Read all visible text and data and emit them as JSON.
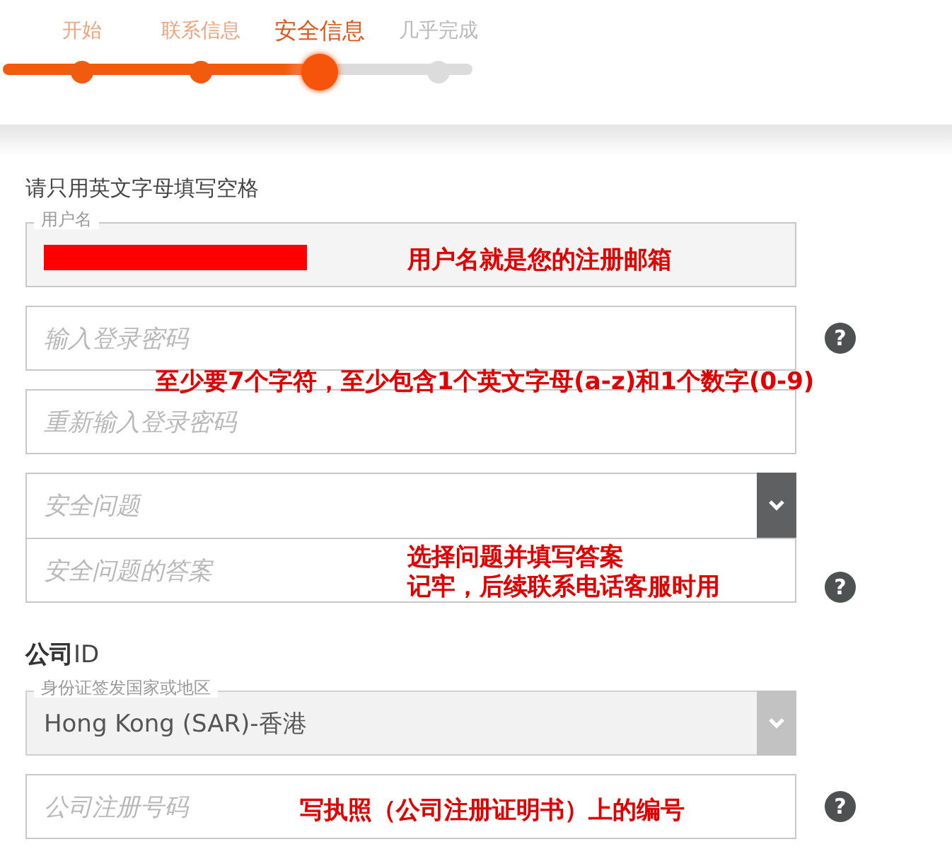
{
  "steps": [
    {
      "label": "开始",
      "kind": "done"
    },
    {
      "label": "联系信息",
      "kind": "done"
    },
    {
      "label": "安全信息",
      "kind": "current"
    },
    {
      "label": "几乎完成",
      "kind": "todo"
    }
  ],
  "form": {
    "instruction": "请只用英文字母填写空格",
    "fields": [
      {
        "kind": "text",
        "label": "用户名",
        "redacted": true,
        "disabled": false
      },
      {
        "kind": "text",
        "placeholder": "输入登录密码",
        "help": "?",
        "disabled": false
      },
      {
        "kind": "text",
        "placeholder": "重新输入登录密码",
        "disabled": false
      },
      {
        "kind": "select",
        "placeholder": "安全问题",
        "joined_next": true,
        "disabled": false
      },
      {
        "kind": "text",
        "placeholder": "安全问题的答案",
        "help": "?",
        "disabled": false
      },
      {
        "kind": "heading",
        "text": "**公司**ID"
      },
      {
        "kind": "select",
        "label": "身份证签发国家或地区",
        "value": "Hong Kong (SAR)-香港",
        "disabled": true
      },
      {
        "kind": "text",
        "placeholder": "公司注册号码",
        "help": "?",
        "disabled": false
      }
    ]
  },
  "annotations": [
    "用户名就是您的注册邮箱",
    "至少要7个字符，至少包含1个英文字母(a-z)和1个数字(0-9)",
    "选择问题并填写答案",
    "记牢，后续联系电话客服时用",
    "写执照（公司注册证明书）上的编号"
  ]
}
